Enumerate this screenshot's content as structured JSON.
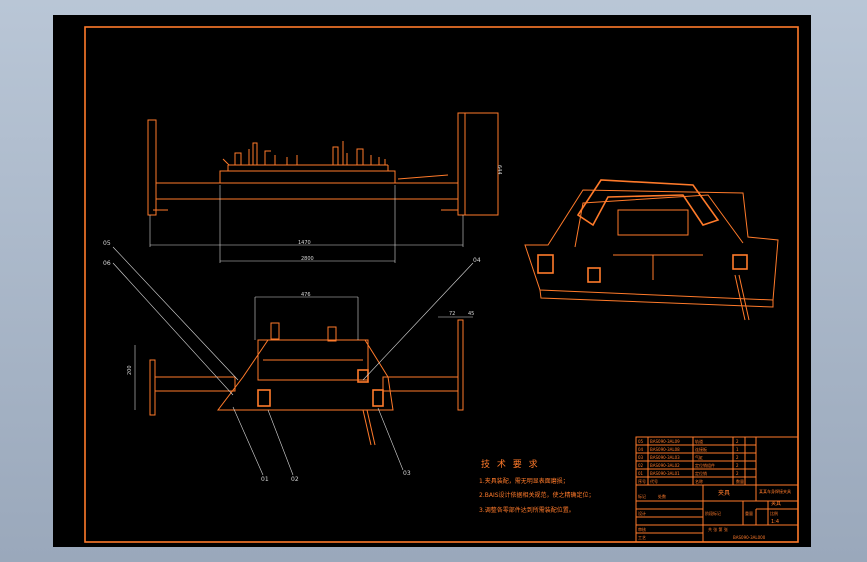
{
  "drawing": {
    "balloons": [
      "01",
      "02",
      "03",
      "04",
      "05",
      "06"
    ],
    "dimensions": {
      "top_width": "1470",
      "top_overall": "2800",
      "top_height": "644",
      "bottom_top": "476",
      "bottom_left_height": "200",
      "bottom_right_a": "72",
      "bottom_right_b": "45"
    },
    "notes": {
      "title": "技 术 要 求",
      "items": [
        "1.夹具装配，需无明显表面磨损；",
        "2.BAIS设计依据相关规范，使之精确定位；",
        "3.调整各零部件达到所需装配位置。"
      ]
    },
    "title_block": {
      "parts_rows": [
        [
          "05",
          "BAS090-3AL09",
          "轨道",
          "2"
        ],
        [
          "04",
          "BAS090-3AL08",
          "连接板",
          "1"
        ],
        [
          "03",
          "BAS090-3AL03",
          "气缸",
          "2"
        ],
        [
          "02",
          "BAS090-3AL02",
          "定位销组件",
          "2"
        ],
        [
          "01",
          "BAS090-3AL01",
          "定位销",
          "2"
        ]
      ],
      "header_row": [
        "序号",
        "代号",
        "名称",
        "数量"
      ],
      "left_labels": [
        "标记",
        "处数",
        "设计",
        "审核",
        "工艺"
      ],
      "center_label": "夹具",
      "sub_labels": [
        "阶段标记",
        "重量",
        "比例"
      ],
      "scale_value": "1:4",
      "right_title": "某某车身焊接夹具",
      "assembly_name": "夹具",
      "drawing_number": "BAS090-3AL000",
      "sheet_label": "共 张 第 张"
    }
  }
}
